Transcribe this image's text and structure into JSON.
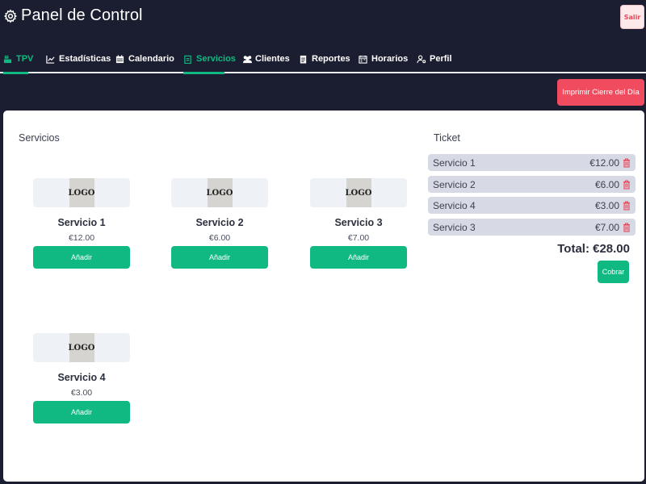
{
  "header": {
    "title": "Panel de Control",
    "logout_label": "Salir"
  },
  "nav": {
    "tabs": [
      {
        "label": "TPV",
        "icon": "cash-register-icon",
        "active": true
      },
      {
        "label": "Estadísticas",
        "icon": "chart-icon",
        "active": false
      },
      {
        "label": "Calendario",
        "icon": "calendar-icon",
        "active": false
      },
      {
        "label": "Servicios",
        "icon": "clipboard-icon",
        "active": false
      },
      {
        "label": "Clientes",
        "icon": "users-icon",
        "active": false
      },
      {
        "label": "Reportes",
        "icon": "report-icon",
        "active": false
      },
      {
        "label": "Horarios",
        "icon": "schedule-icon",
        "active": false
      },
      {
        "label": "Perfil",
        "icon": "user-gear-icon",
        "active": false
      }
    ]
  },
  "actions": {
    "print_label": "Imprimir Cierre del Día"
  },
  "services": {
    "title": "Servicios",
    "items": [
      {
        "name": "Servicio 1",
        "price": "€12.00",
        "logo": "LOGO",
        "add_label": "Añadir"
      },
      {
        "name": "Servicio 2",
        "price": "€6.00",
        "logo": "LOGO",
        "add_label": "Añadir"
      },
      {
        "name": "Servicio 3",
        "price": "€7.00",
        "logo": "LOGO",
        "add_label": "Añadir"
      },
      {
        "name": "Servicio 4",
        "price": "€3.00",
        "logo": "LOGO",
        "add_label": "Añadir"
      }
    ]
  },
  "ticket": {
    "title": "Ticket",
    "rows": [
      {
        "name": "Servicio 1",
        "price": "€12.00"
      },
      {
        "name": "Servicio 2",
        "price": "€6.00"
      },
      {
        "name": "Servicio 4",
        "price": "€3.00"
      },
      {
        "name": "Servicio 3",
        "price": "€7.00"
      }
    ],
    "total": "Total: €28.00",
    "charge_label": "Cobrar"
  },
  "colors": {
    "background": "#1b1d30",
    "accent": "#10b981",
    "danger": "#f04b5e",
    "ticket_row": "#d7d9e4"
  }
}
